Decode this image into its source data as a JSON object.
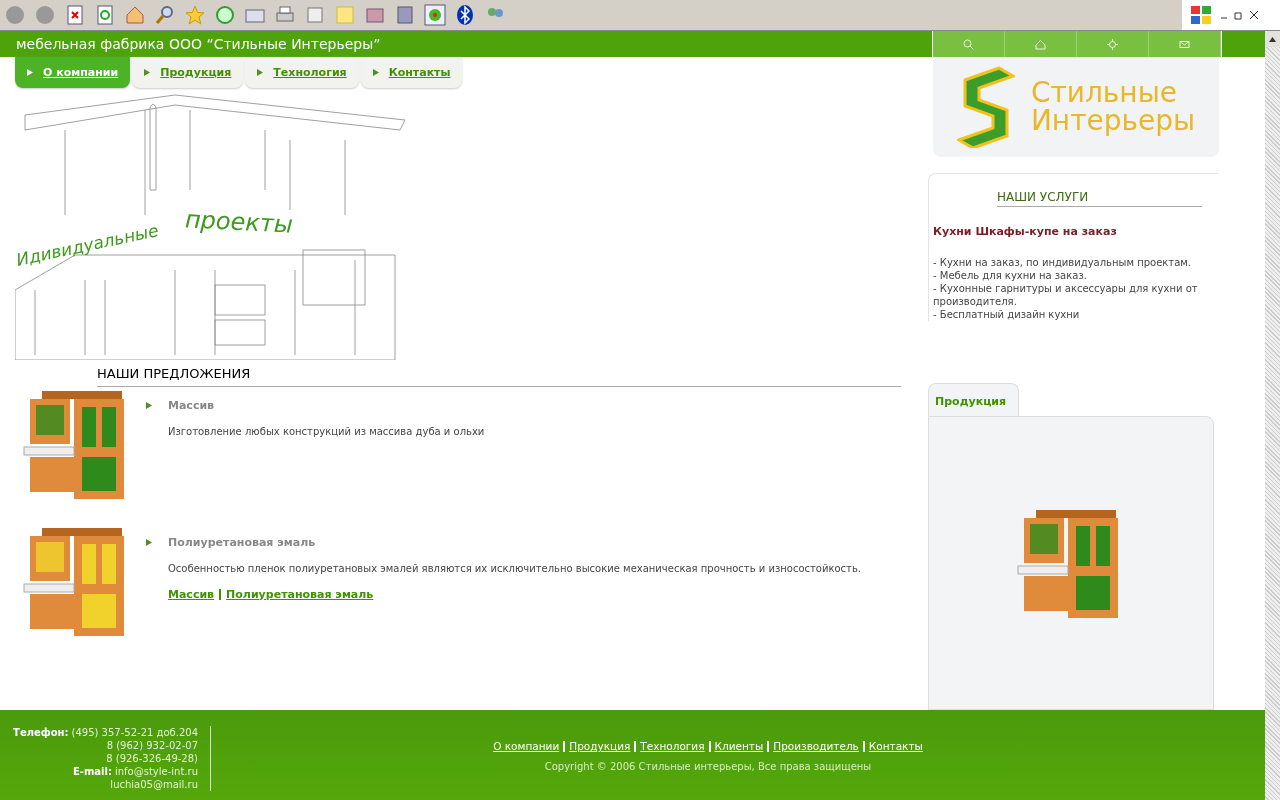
{
  "header": {
    "title": "мебельная фабрика ООО “Стильные Интерьеры”"
  },
  "nav": [
    {
      "label": "О компании",
      "selected": true
    },
    {
      "label": "Продукция",
      "selected": false
    },
    {
      "label": "Технология",
      "selected": false
    },
    {
      "label": "Контакты",
      "selected": false
    }
  ],
  "banner": {
    "line_1": "Идивидуальные",
    "line_2": "проекты"
  },
  "logo": {
    "line_1": "Стильные",
    "line_2": "Интерьеры"
  },
  "offers": {
    "title": "НАШИ ПРЕДЛОЖЕНИЯ",
    "items": [
      {
        "title": "Массив",
        "description": "Изготовление любых конструкций из массива дуба и ольхи"
      },
      {
        "title": "Полиуретановая эмаль",
        "description": "Особенностью пленок полиуретановых эмалей являются их исключительно высокие механическая прочность и износостойкость."
      }
    ],
    "links": [
      "Массив",
      "Полиуретановая эмаль"
    ]
  },
  "services": {
    "title": "НАШИ УСЛУГИ",
    "subtitle": "Кухни Шкафы-купе на заказ",
    "lines": [
      "- Кухни на заказ, по индивидуальным проектам.",
      "- Мебель для кухни на заказ.",
      "- Кухонные гарнитуры и аксессуары для кухни от производителя.",
      "- Бесплатный дизайн кухни"
    ]
  },
  "products_panel": {
    "tab": "Продукция"
  },
  "footer": {
    "contacts": [
      {
        "label": "Телефон:",
        "value": "(495) 357-52-21 доб.204"
      },
      {
        "value": "8 (962) 932-02-07"
      },
      {
        "value": "8 (926-326-49-28)"
      },
      {
        "label": "E-mail:",
        "value": "info@style-int.ru"
      },
      {
        "value": "luchia05@mail.ru"
      }
    ],
    "links": [
      "О компании",
      "Продукция",
      "Технология",
      "Клиенты",
      "Производитель",
      "Контакты"
    ],
    "copyright": "Copyright © 2006 Стильные интерьеры, Все права защищены"
  }
}
